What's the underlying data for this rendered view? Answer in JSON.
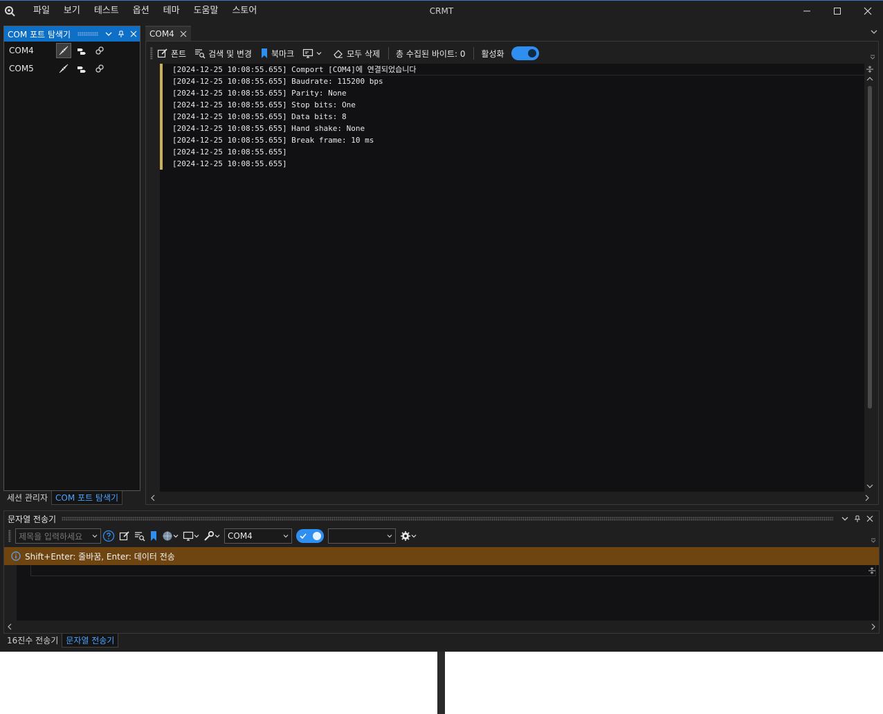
{
  "app": {
    "title": "CRMT",
    "menu": [
      "파일",
      "보기",
      "테스트",
      "옵션",
      "테마",
      "도움말",
      "스토어"
    ]
  },
  "left_panel": {
    "title": "COM 포트 탐색기",
    "ports": [
      {
        "name": "COM4"
      },
      {
        "name": "COM5"
      }
    ],
    "tabs": [
      "세션 관리자",
      "COM 포트 탐색기"
    ]
  },
  "document": {
    "tab_label": "COM4",
    "toolbar": {
      "font": "폰트",
      "search_replace": "검색 및 변경",
      "bookmark": "북마크",
      "clear_all": "모두 삭제",
      "received_bytes": "총 수집된 바이트: 0",
      "enable": "활성화"
    },
    "log_lines": [
      "[2024-12-25 10:08:55.655] Comport [COM4]에 연결되었습니다",
      "[2024-12-25 10:08:55.655] Baudrate: 115200 bps",
      "[2024-12-25 10:08:55.655] Parity: None",
      "[2024-12-25 10:08:55.655] Stop bits: One",
      "[2024-12-25 10:08:55.655] Data bits: 8",
      "[2024-12-25 10:08:55.655] Hand shake: None",
      "[2024-12-25 10:08:55.655] Break frame: 10 ms",
      "[2024-12-25 10:08:55.655]",
      "[2024-12-25 10:08:55.655]"
    ]
  },
  "string_sender": {
    "title": "문자열 전송기",
    "title_placeholder": "제목을 입력하세요",
    "port_value": "COM4",
    "secondary_value": "",
    "info": "Shift+Enter: 줄바꿈, Enter: 데이터 전송",
    "tabs": [
      "16진수 전송기",
      "문자열 전송기"
    ]
  },
  "colors": {
    "accent": "#0e6fc6",
    "toggle": "#2f8ff0",
    "info_bar": "#6e4411",
    "gutter_marker": "#c9b15a"
  }
}
